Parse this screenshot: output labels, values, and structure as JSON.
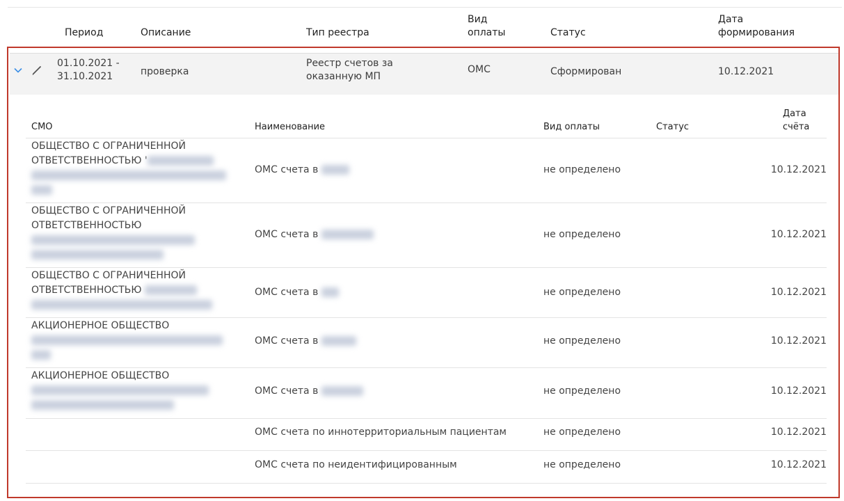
{
  "header": {
    "period": "Период",
    "description": "Описание",
    "registry_type": "Тип реестра",
    "payment_type_l1": "Вид",
    "payment_type_l2": "оплаты",
    "status": "Статус",
    "formed_date_l1": "Дата",
    "formed_date_l2": "формирования"
  },
  "row": {
    "period_l1": "01.10.2021 -",
    "period_l2": "31.10.2021",
    "description": "проверка",
    "registry_type_l1": "Реестр счетов за",
    "registry_type_l2": "оказанную МП",
    "payment": "ОМС",
    "status": "Сформирован",
    "date": "10.12.2021"
  },
  "sub_header": {
    "smo": "СМО",
    "name": "Наименование",
    "payment_type": "Вид оплаты",
    "status": "Статус",
    "date_l1": "Дата",
    "date_l2": "счёта"
  },
  "sub_rows": [
    {
      "smo_l1": "ОБЩЕСТВО С ОГРАНИЧЕННОЙ",
      "smo_l2": "ОТВЕТСТВЕННОСТЬЮ '",
      "name": "ОМС счета в",
      "payment": "не определено",
      "date": "10.12.2021"
    },
    {
      "smo_l1": "ОБЩЕСТВО С ОГРАНИЧЕННОЙ",
      "smo_l2": "ОТВЕТСТВЕННОСТЬЮ",
      "name": "ОМС счета в",
      "payment": "не определено",
      "date": "10.12.2021"
    },
    {
      "smo_l1": "ОБЩЕСТВО С ОГРАНИЧЕННОЙ",
      "smo_l2": "ОТВЕТСТВЕННОСТЬЮ",
      "name": "ОМС счета в",
      "payment": "не определено",
      "date": "10.12.2021"
    },
    {
      "smo_l1": "АКЦИОНЕРНОЕ ОБЩЕСТВО",
      "name": "ОМС счета в",
      "payment": "не определено",
      "date": "10.12.2021"
    },
    {
      "smo_l1": "АКЦИОНЕРНОЕ ОБЩЕСТВО",
      "name": "ОМС счета в",
      "payment": "не определено",
      "date": "10.12.2021"
    },
    {
      "name": "ОМС счета по иннотерриториальным пациентам",
      "payment": "не определено",
      "date": "10.12.2021"
    },
    {
      "name": "ОМС счета по неидентифицированным",
      "payment": "не определено",
      "date": "10.12.2021"
    }
  ],
  "icons": {
    "expand": "chevron-down-icon",
    "edit": "pencil-icon"
  },
  "colors": {
    "frame": "#c0392b",
    "accent": "#3a8ee6",
    "row_bg": "#f3f3f3"
  }
}
